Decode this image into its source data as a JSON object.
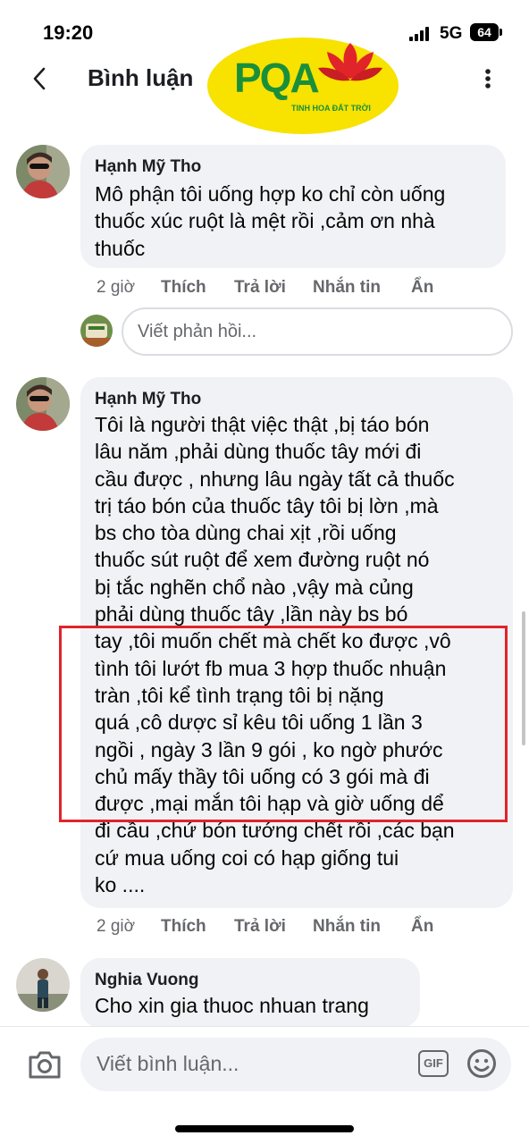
{
  "status_bar": {
    "time": "19:20",
    "network": "5G",
    "battery": "64"
  },
  "header": {
    "title": "Bình luận",
    "logo_text": "PQA",
    "logo_tagline": "TINH HOA ĐẤT TRỜI"
  },
  "comments": [
    {
      "author": "Hạnh Mỹ Tho",
      "text": "Mô phận tôi uống hợp ko chỉ còn uống\nthuốc xúc ruột là mệt rồi ,cảm ơn nhà\nthuốc",
      "time": "2 giờ",
      "like": "Thích",
      "reply": "Trả lời",
      "message": "Nhắn tin",
      "hide": "Ẩn"
    },
    {
      "author": "Hạnh Mỹ Tho",
      "text": "Tôi là người thật việc thật ,bị táo bón\nlâu năm ,phải dùng thuốc tây mới đi\ncầu được , nhưng lâu ngày tất cả thuốc\ntrị táo bón của thuốc tây tôi bị lờn ,mà\nbs cho tòa dùng chai xịt ,rồi uống\nthuốc sút ruột để xem đường ruột nó\nbị tắc nghẽn chổ nào ,vậy mà củng\nphải dùng thuốc tây ,lần này bs bó\ntay ,tôi muốn chết mà chết ko được ,vô\ntình tôi lướt fb mua 3 hợp thuốc nhuận\ntràn ,tôi kể tình trạng tôi bị nặng\nquá ,cô dược sỉ kêu tôi uống 1 lần 3\nngồi , ngày 3 lần 9 gói , ko ngờ phước\nchủ mấy thầy tôi uống có 3 gói mà đi\nđược ,mại mắn tôi hạp và giờ uống dể\nđi cầu ,chứ bón tướng chết rồi ,các bạn\ncứ mua uống coi có hạp giống tui\nko ....",
      "time": "2 giờ",
      "like": "Thích",
      "reply": "Trả lời",
      "message": "Nhắn tin",
      "hide": "Ẩn"
    },
    {
      "author": "Nghia Vuong",
      "text": "Cho xin gia thuoc nhuan trang"
    }
  ],
  "reply_box": {
    "placeholder": "Viết phản hồi..."
  },
  "composer": {
    "placeholder": "Viết bình luận...",
    "gif_label": "GIF"
  },
  "colors": {
    "highlight": "#e0242a",
    "logo_bg": "#f7e200",
    "logo_green": "#1a8f3a"
  },
  "icons": [
    "back-arrow-icon",
    "more-vertical-icon",
    "camera-icon",
    "gif-icon",
    "emoji-icon",
    "signal-icon",
    "battery-icon"
  ]
}
